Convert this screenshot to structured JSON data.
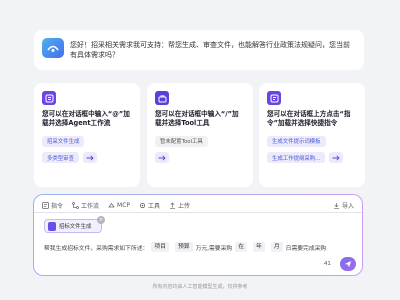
{
  "greeting": {
    "icon": "assistant-logo-icon",
    "text": "您好！招采相关需求我可支持：帮您生成、审查文件，也能解答行业政策法规疑问，您当前有具体需求吗？"
  },
  "cards": [
    {
      "icon": "agent-box-icon",
      "icon_color": "#6b46e5",
      "title": "您可以在对话框中输入“@”加载并选择Agent工作流",
      "chips": [
        "招采文件生成",
        "多类型审查"
      ],
      "chip_bg": "#eceafb"
    },
    {
      "icon": "toolbox-icon",
      "icon_color": "#5b3fd9",
      "title": "您可以在对话框中输入“/”加载并选择Tool工具",
      "chips": [
        "暂未配置Tool工具"
      ],
      "chip_bg": "#f1f1f4"
    },
    {
      "icon": "command-list-icon",
      "icon_color": "#6a44e0",
      "title": "您可以在对话框上方点击“指令”加载并选择快捷指令",
      "chips": [
        "生成文件提示词模板",
        "生成工作提纲采购..."
      ],
      "chip_bg": "#eceafb"
    }
  ],
  "toolbar": {
    "instruction": "指令",
    "workflow": "工作流",
    "mcp": "MCP",
    "tools": "工具",
    "upload": "上传",
    "import": "导入"
  },
  "attachment": {
    "name": "招标文件生成"
  },
  "template": {
    "prefix": "帮我生成招标文件，采购需求如下所述：",
    "slot_project": "项目",
    "slot_budget": "预算",
    "unit_wan": "万元,需要采购",
    "slot_time": "在",
    "slot_year": "年",
    "slot_month": "月",
    "suffix": "日需要完成采购"
  },
  "char_count": "41",
  "footnote": "所有内容均由人工智能模型生成，仅供参考"
}
